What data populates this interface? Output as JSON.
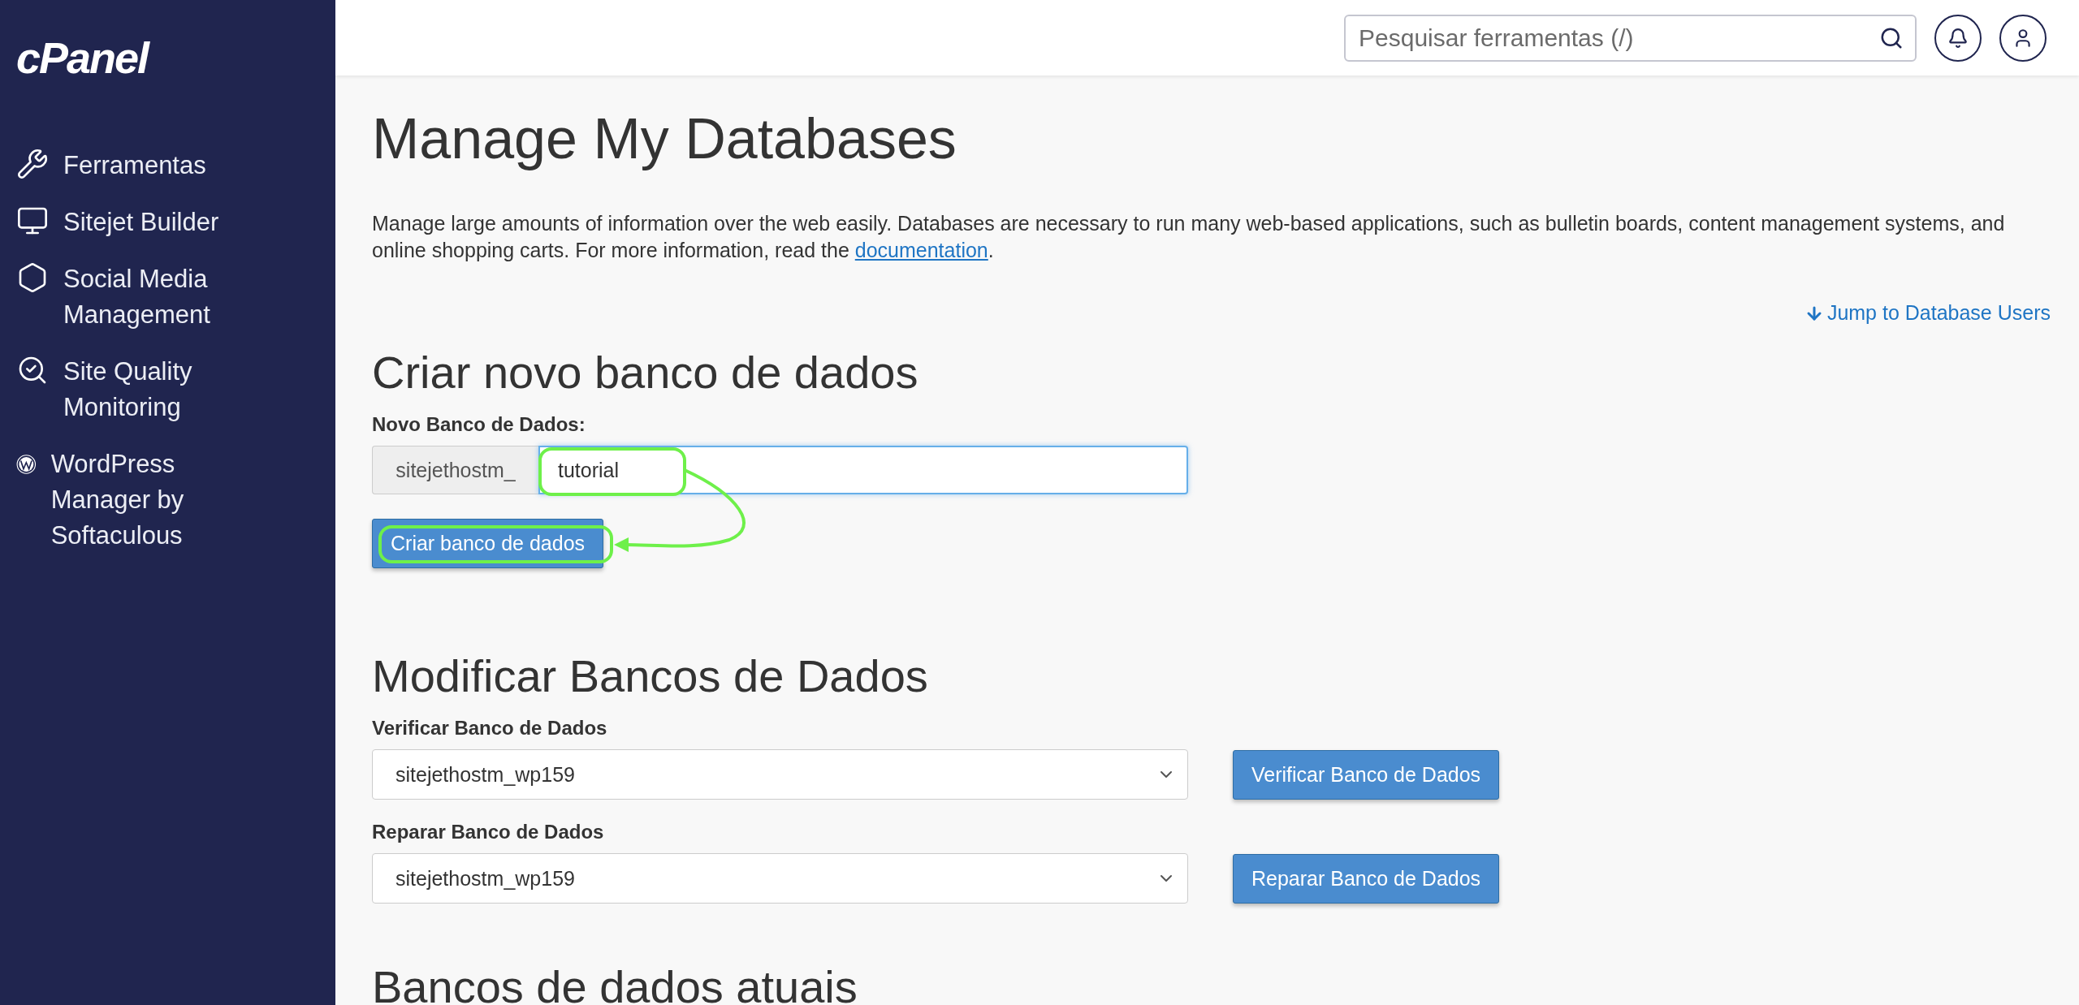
{
  "sidebar": {
    "logo": "cPanel",
    "items": [
      {
        "label": "Ferramentas"
      },
      {
        "label": "Sitejet Builder"
      },
      {
        "label": "Social Media Management"
      },
      {
        "label": "Site Quality Monitoring"
      },
      {
        "label": "WordPress Manager by Softaculous"
      }
    ]
  },
  "topbar": {
    "search": {
      "placeholder": "Pesquisar ferramentas (/)"
    }
  },
  "page": {
    "title": "Manage My Databases",
    "description": "Manage large amounts of information over the web easily. Databases are necessary to run many web-based applications, such as bulletin boards, content management systems, and online shopping carts. For more information, read the ",
    "description_link": "documentation",
    "description_end": ".",
    "jump_link": "Jump to Database Users"
  },
  "create": {
    "heading": "Criar novo banco de dados",
    "label": "Novo Banco de Dados:",
    "prefix": "sitejethostm_",
    "value": "tutorial",
    "button": "Criar banco de dados"
  },
  "modify": {
    "heading": "Modificar Bancos de Dados",
    "rows": [
      {
        "label": "Verificar Banco de Dados",
        "value": "sitejethostm_wp159",
        "button": "Verificar Banco de Dados"
      },
      {
        "label": "Reparar Banco de Dados",
        "value": "sitejethostm_wp159",
        "button": "Reparar Banco de Dados"
      }
    ]
  },
  "current": {
    "heading": "Bancos de dados atuais"
  }
}
